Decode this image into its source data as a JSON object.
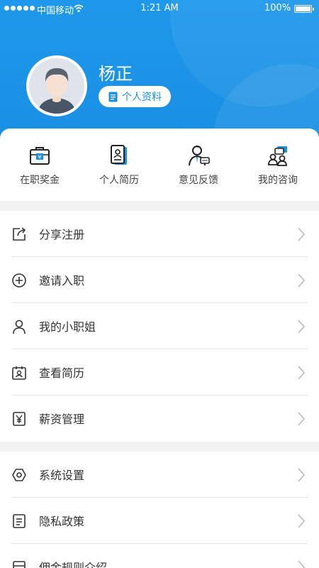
{
  "status_bar": {
    "carrier": "中国移动",
    "time": "1:21 AM",
    "battery": "100%"
  },
  "profile": {
    "name": "杨正",
    "profile_button_label": "个人资料"
  },
  "quick_actions": [
    {
      "label": "在职奖金",
      "icon": "bonus-briefcase-icon"
    },
    {
      "label": "个人简历",
      "icon": "resume-icon"
    },
    {
      "label": "意见反馈",
      "icon": "feedback-icon"
    },
    {
      "label": "我的咨询",
      "icon": "consult-icon"
    }
  ],
  "menu_group_1": [
    {
      "label": "分享注册",
      "icon": "share-icon"
    },
    {
      "label": "邀请入职",
      "icon": "plus-circle-icon"
    },
    {
      "label": "我的小职姐",
      "icon": "person-icon"
    },
    {
      "label": "查看简历",
      "icon": "id-card-icon"
    },
    {
      "label": "薪资管理",
      "icon": "yen-icon"
    }
  ],
  "menu_group_2": [
    {
      "label": "系统设置",
      "icon": "hexagon-settings-icon"
    },
    {
      "label": "隐私政策",
      "icon": "document-icon"
    },
    {
      "label": "佣金规则介绍",
      "icon": "rules-icon"
    }
  ],
  "colors": {
    "primary": "#1a8fe3",
    "background": "#f2f2f2"
  }
}
